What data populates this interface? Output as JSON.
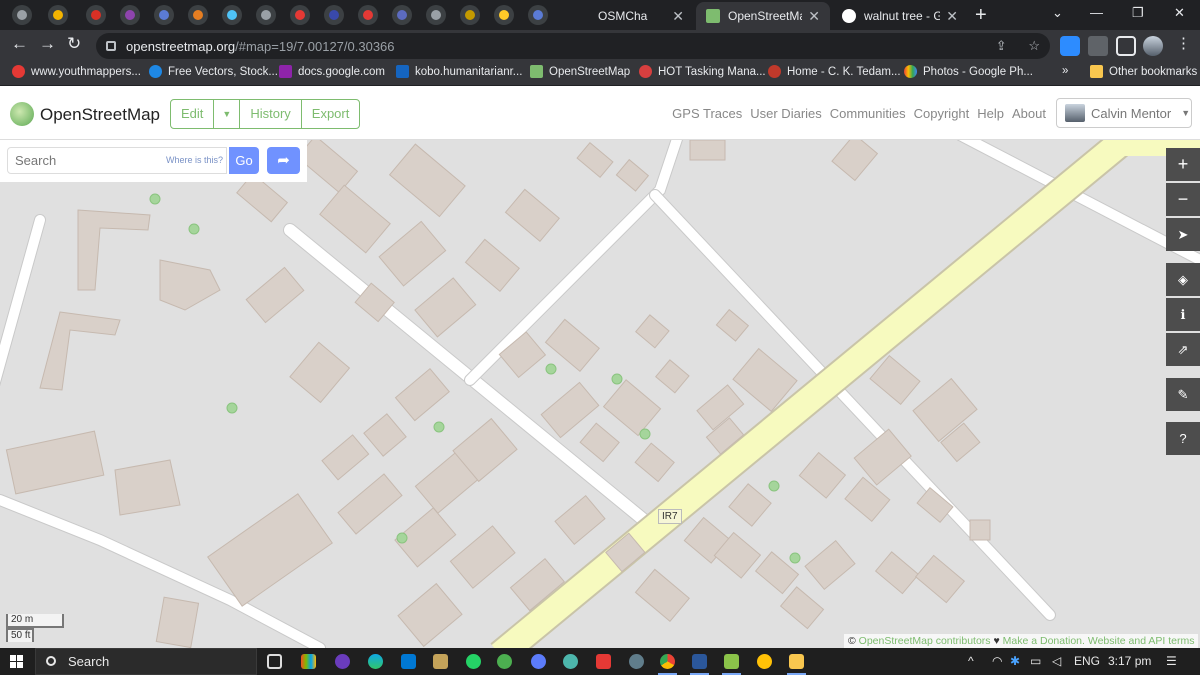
{
  "browser": {
    "tabs": [
      {
        "title": "OSMCha",
        "active": false
      },
      {
        "title": "OpenStreetMap",
        "active": true
      },
      {
        "title": "walnut tree - Go",
        "active": false
      }
    ],
    "close_glyph": "✕",
    "new_tab_glyph": "+",
    "window_controls": [
      "⌄",
      "—",
      "❐",
      "✕"
    ],
    "nav": {
      "back": "←",
      "forward": "→",
      "reload": "↻"
    },
    "url_host": "openstreetmap.org",
    "url_path": "/#map=19/7.00127/0.30366",
    "omnibox_icons": [
      "⇪",
      "☆"
    ],
    "bookmarks": [
      "www.youthmappers...",
      "Free Vectors, Stock...",
      "docs.google.com",
      "kobo.humanitarianr...",
      "OpenStreetMap",
      "HOT Tasking Mana...",
      "Home - C. K. Tedam...",
      "Photos - Google Ph..."
    ],
    "bookmarks_overflow": "»",
    "other_bookmarks": "Other bookmarks"
  },
  "osm": {
    "brand": "OpenStreetMap",
    "edit_label": "Edit",
    "edit_caret": "▼",
    "history_label": "History",
    "export_label": "Export",
    "nav_links": [
      "GPS Traces",
      "User Diaries",
      "Communities",
      "Copyright",
      "Help",
      "About"
    ],
    "user_name": "Calvin Mentor",
    "user_caret": "▼",
    "search_placeholder": "Search",
    "where_is_this": "Where is this?",
    "go_label": "Go",
    "directions_glyph": "➦",
    "map_controls": {
      "zoom_in": "+",
      "zoom_out": "−",
      "locate": "➤",
      "layers": "◈",
      "info": "ℹ",
      "share": "⇗",
      "note": "✎",
      "query": "?"
    },
    "scale": {
      "metric": "20 m",
      "imperial": "50 ft"
    },
    "road_label": "IR7",
    "attribution": {
      "copyright": "© ",
      "contributors": "OpenStreetMap contributors",
      "heart": " ♥ ",
      "donation": "Make a Donation.",
      "api_terms": "Website and API terms"
    }
  },
  "taskbar": {
    "search_label": "Search",
    "tray_chevron": "^",
    "language": "ENG",
    "time": "3:17 pm"
  },
  "colors": {
    "map_background": "#e0e0e0",
    "building": "#d9d0c9",
    "building_outline": "#c6b9af",
    "road": "#ffffff",
    "trunk_road": "#f7fabf",
    "tree": "#a5d59b",
    "osm_green": "#7ebc6f",
    "go_button": "#7092ff"
  }
}
